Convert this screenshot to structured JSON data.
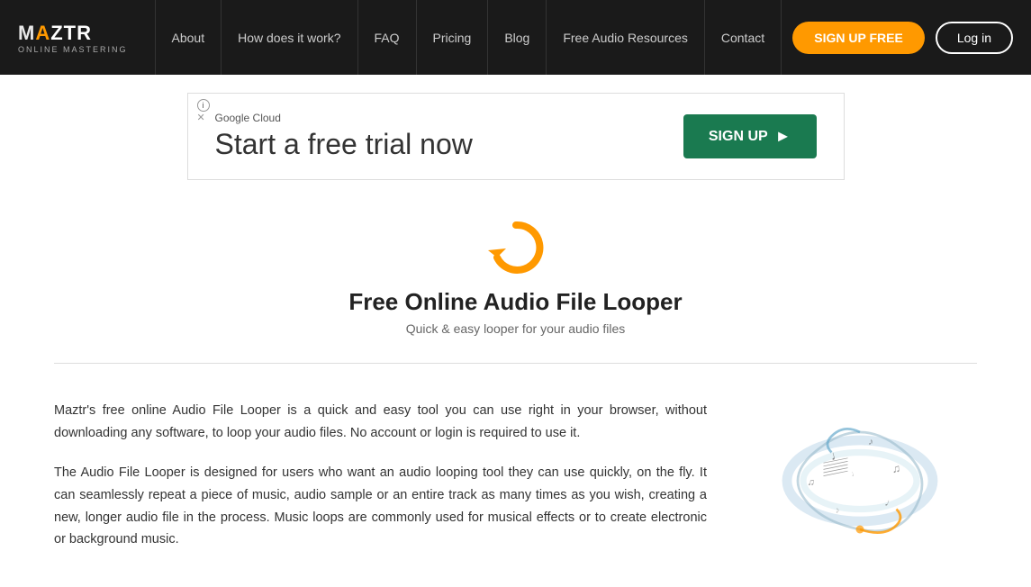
{
  "navbar": {
    "logo": {
      "brand": "MAZTR",
      "tagline": "ONLINE MASTERING"
    },
    "links": [
      {
        "id": "about",
        "label": "About"
      },
      {
        "id": "how-it-works",
        "label": "How does it work?"
      },
      {
        "id": "faq",
        "label": "FAQ"
      },
      {
        "id": "pricing",
        "label": "Pricing"
      },
      {
        "id": "blog",
        "label": "Blog"
      },
      {
        "id": "free-audio-resources",
        "label": "Free Audio Resources"
      },
      {
        "id": "contact",
        "label": "Contact"
      }
    ],
    "signup_label": "SIGN UP FREE",
    "login_label": "Log in"
  },
  "ad": {
    "provider": "Google Cloud",
    "headline": "Start a free trial now",
    "cta_label": "SIGN UP"
  },
  "hero": {
    "title": "Free Online Audio File Looper",
    "subtitle": "Quick & easy looper for your audio files"
  },
  "content": {
    "paragraph1": "Maztr's free online Audio File Looper is a quick and easy tool you can use right in your browser, without downloading any software, to loop your audio files. No account or login is required to use it.",
    "paragraph2": "The Audio File Looper is designed for users who want an audio looping tool they can use quickly, on the fly. It can seamlessly repeat a piece of music, audio sample or an entire track as many times as you wish, creating a new, longer audio file in the process. Music loops are commonly used for musical effects or to create electronic or background music."
  },
  "colors": {
    "accent": "#f90",
    "navbar_bg": "#1a1a1a",
    "ad_green": "#1a7a50"
  }
}
